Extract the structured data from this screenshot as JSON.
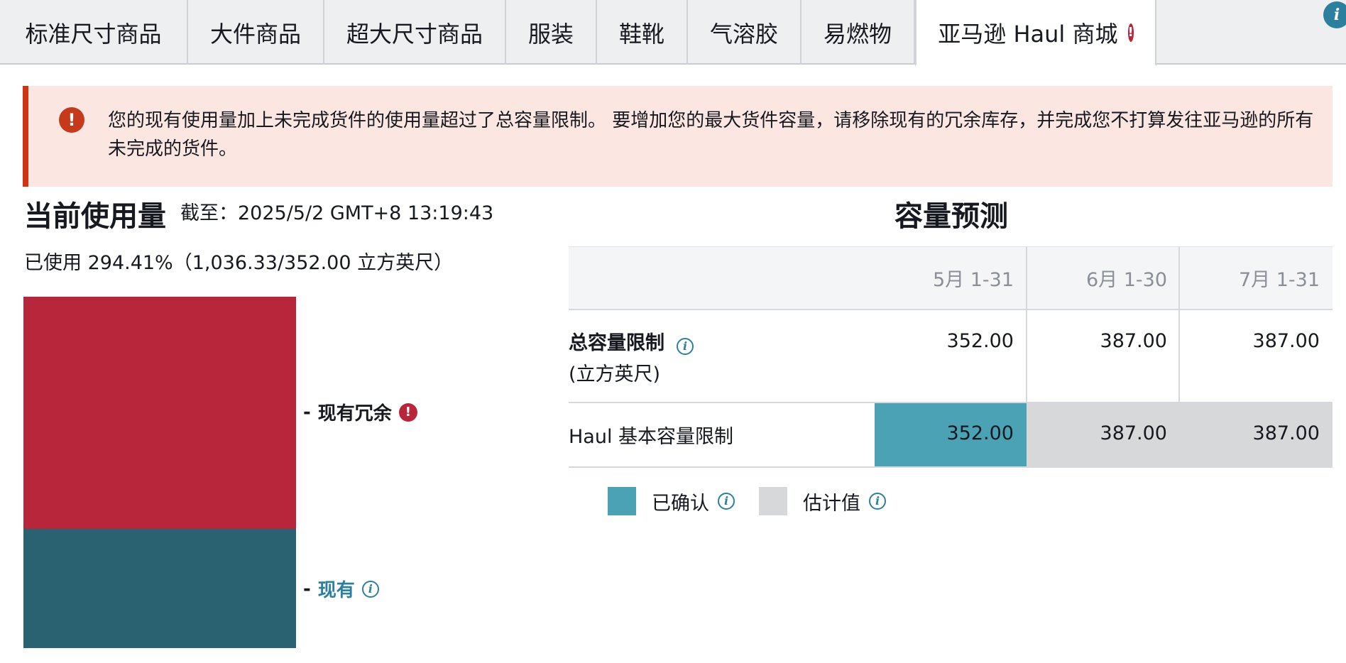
{
  "tabs": [
    {
      "label": "标准尺寸商品"
    },
    {
      "label": "大件商品"
    },
    {
      "label": "超大尺寸商品"
    },
    {
      "label": "服装"
    },
    {
      "label": "鞋靴"
    },
    {
      "label": "气溶胶"
    },
    {
      "label": "易燃物"
    },
    {
      "label": "亚马逊 Haul 商城",
      "active": true,
      "error": true
    }
  ],
  "alert": {
    "message": "您的现有使用量加上未完成货件的使用量超过了总容量限制。 要增加您的最大货件容量，请移除现有的冗余库存，并完成您不打算发往亚马逊的所有未完成的货件。"
  },
  "usage": {
    "title": "当前使用量",
    "as_of": "截至：2025/5/2 GMT+8 13:19:43",
    "summary": "已使用 294.41%（1,036.33/352.00 立方英尺）",
    "legend_excess": "现有冗余",
    "legend_current": "现有",
    "dash": "-"
  },
  "forecast": {
    "title": "容量预测",
    "columns": [
      "5月 1-31",
      "6月 1-30",
      "7月 1-31"
    ],
    "rows": [
      {
        "label_line1": "总容量限制",
        "label_line2": "(立方英尺)",
        "values": [
          "352.00",
          "387.00",
          "387.00"
        ]
      },
      {
        "label_line1": "Haul 基本容量限制",
        "values": [
          "352.00",
          "387.00",
          "387.00"
        ]
      }
    ],
    "legend_confirmed": "已确认",
    "legend_estimated": "估计值"
  },
  "colors": {
    "excess": "#b7263b",
    "current": "#2a6272",
    "confirmed": "#4aa2b4",
    "estimated": "#d6d8da",
    "error": "#d13212",
    "link": "#2d7f9e"
  },
  "icons": {
    "alert": "exclamation-circle-icon",
    "info": "info-circle-icon"
  }
}
